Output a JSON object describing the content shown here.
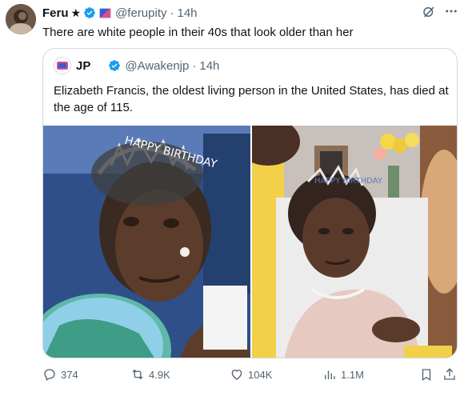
{
  "author": {
    "name": "Feru",
    "badge_star": "★",
    "handle": "@ferupity",
    "separator": "·",
    "time": "14h"
  },
  "tweet": {
    "text": "There are white people in their 40s that look older than her"
  },
  "quoted": {
    "name": "JP",
    "handle": "@Awakenjp",
    "separator": "·",
    "time": "14h",
    "text": "Elizabeth Francis, the oldest living person in the United States, has died at the age of 115.",
    "photo_left_crown_text": "HAPPY BIRTHDAY",
    "photo_right_crown_text": "HAPPY BIRTHDAY"
  },
  "actions": {
    "replies": "374",
    "reposts": "4.9K",
    "likes": "104K",
    "views": "1.1M"
  },
  "colors": {
    "verified": "#1d9bf0",
    "secondary_text": "#536471",
    "border": "#cfd9de",
    "primary_text": "#0f1419"
  },
  "icons": {
    "more": "more-icon",
    "grok": "grok-icon",
    "reply": "reply-icon",
    "repost": "repost-icon",
    "like": "heart-icon",
    "views": "views-icon",
    "bookmark": "bookmark-icon",
    "share": "share-icon"
  }
}
